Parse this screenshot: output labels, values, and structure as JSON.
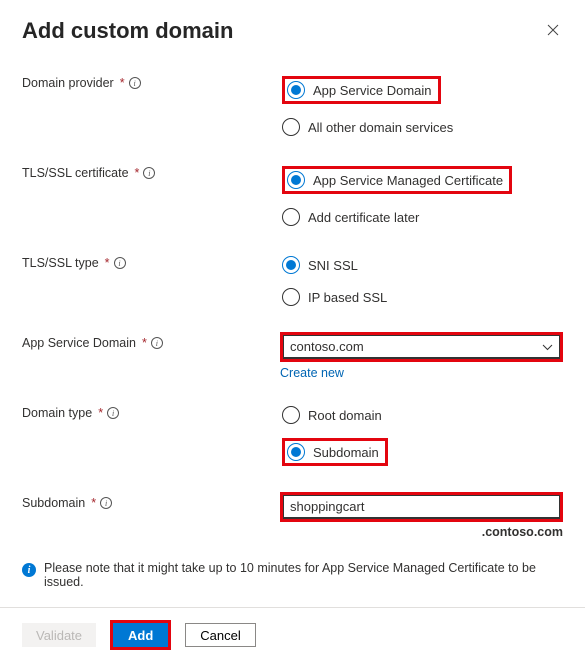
{
  "header": {
    "title": "Add custom domain"
  },
  "domainProvider": {
    "label": "Domain provider",
    "opt1": "App Service Domain",
    "opt2": "All other domain services"
  },
  "tlsCert": {
    "label": "TLS/SSL certificate",
    "opt1": "App Service Managed Certificate",
    "opt2": "Add certificate later"
  },
  "tlsType": {
    "label": "TLS/SSL type",
    "opt1": "SNI SSL",
    "opt2": "IP based SSL"
  },
  "appServiceDomain": {
    "label": "App Service Domain",
    "value": "contoso.com",
    "createNew": "Create new"
  },
  "domainType": {
    "label": "Domain type",
    "opt1": "Root domain",
    "opt2": "Subdomain"
  },
  "subdomain": {
    "label": "Subdomain",
    "value": "shoppingcart",
    "suffix": ".contoso.com"
  },
  "note": "Please note that it might take up to 10 minutes for App Service Managed Certificate to be issued.",
  "footer": {
    "validate": "Validate",
    "add": "Add",
    "cancel": "Cancel"
  }
}
